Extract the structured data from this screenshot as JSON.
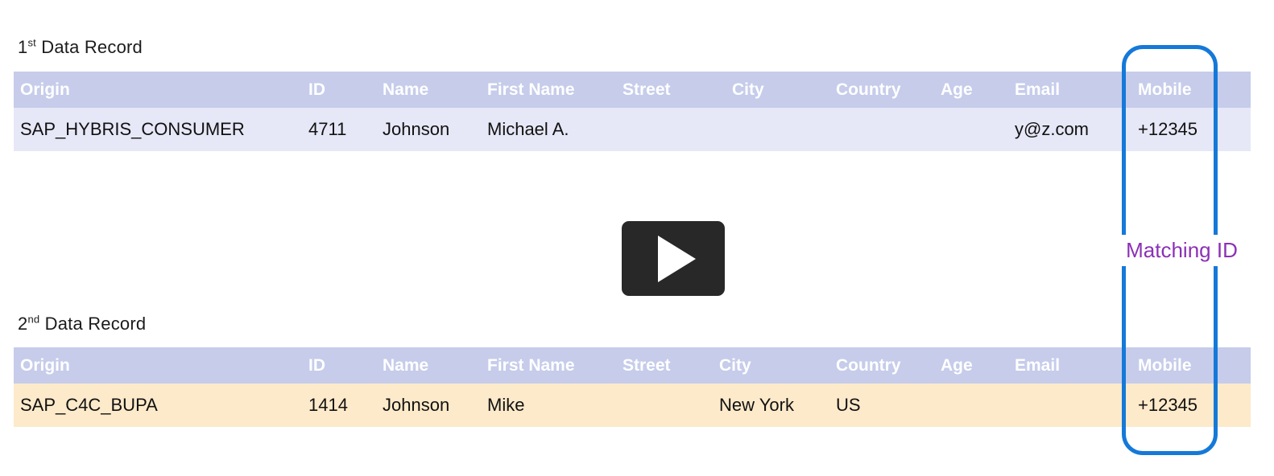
{
  "records": [
    {
      "caption_number": "1",
      "caption_ordinal": "st",
      "caption_text": " Data Record",
      "columns": [
        "Origin",
        "ID",
        "Name",
        "First Name",
        "Street",
        "City",
        "Country",
        "Age",
        "Email",
        "Mobile"
      ],
      "row": {
        "origin": "SAP_HYBRIS_CONSUMER",
        "id": "4711",
        "name": "Johnson",
        "first_name": "Michael A.",
        "street": "",
        "city": "",
        "country": "",
        "age": "",
        "email": "y@z.com",
        "mobile": "+12345"
      },
      "row_color": "#e6e8f7"
    },
    {
      "caption_number": "2",
      "caption_ordinal": "nd",
      "caption_text": " Data Record",
      "columns": [
        "Origin",
        "ID",
        "Name",
        "First Name",
        "Street",
        "City",
        "Country",
        "Age",
        "Email",
        "Mobile"
      ],
      "row": {
        "origin": "SAP_C4C_BUPA",
        "id": "1414",
        "name": "Johnson",
        "first_name": "Mike",
        "street": "",
        "city": "New York",
        "country": "US",
        "age": "",
        "email": "",
        "mobile": "+12345"
      },
      "row_color": "#fdeaca"
    }
  ],
  "annotation": {
    "match_label": "Matching ID",
    "match_label_color": "#8c30b6",
    "highlight_border_color": "#1579d8"
  },
  "media": {
    "play_button_label": "Play",
    "play_button_color": "#282828"
  },
  "colors": {
    "header_background": "#c6ccea",
    "header_text": "#ffffff",
    "page_background": "#ffffff"
  }
}
